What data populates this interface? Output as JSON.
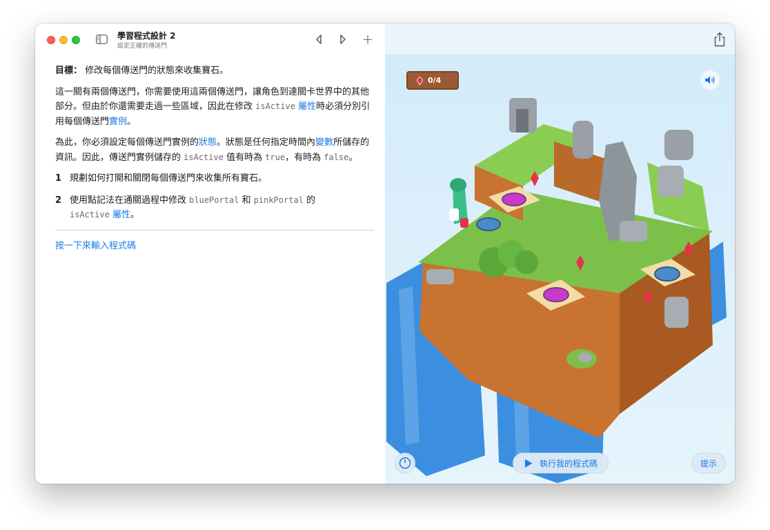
{
  "window": {
    "title": "學習程式設計 2",
    "subtitle": "設定正確的傳送門"
  },
  "toolbar": {
    "back_icon": "chevron-left-icon",
    "forward_icon": "chevron-right-icon",
    "add_label": "+",
    "share_icon": "share-icon",
    "sidebar_icon": "sidebar-icon"
  },
  "instructions": {
    "goal_label": "目標：",
    "goal_text": "修改每個傳送門的狀態來收集寶石。",
    "para1": {
      "part1": "這一關有兩個傳送門，你需要使用這兩個傳送門，讓角色到達關卡世界中的其他部分。但由於你還需要走過一些區域，因此在修改 ",
      "code1": "isActive",
      "link1": "屬性",
      "part2": "時必須分別引用每個傳送門",
      "link2": "實例",
      "part3": "。"
    },
    "para2": {
      "part1": "為此，你必須設定每個傳送門實例的",
      "link1": "狀態",
      "part2": "。狀態是任何指定時間內",
      "link2": "變數",
      "part3": "所儲存的資訊。因此，傳送門實例儲存的 ",
      "code1": "isActive",
      "part4": " 值有時為 ",
      "code2": "true",
      "part5": "，有時為 ",
      "code3": "false",
      "part6": "。"
    },
    "steps": [
      {
        "num": "1",
        "text": "規劃如何打開和關閉每個傳送門來收集所有寶石。"
      },
      {
        "num": "2",
        "part1": "使用點記法在通關過程中修改 ",
        "code1": "bluePortal",
        "part2": " 和 ",
        "code2": "pinkPortal",
        "part3": " 的 ",
        "code3": "isActive",
        "part4": " ",
        "link1": "屬性",
        "part5": "。"
      }
    ],
    "cta": "按一下來輸入程式碼"
  },
  "game": {
    "gem_count": "0/4",
    "gems_collected": 0,
    "gems_total": 4,
    "run_label": "執行我的程式碼",
    "hint_label": "提示",
    "speed_icon": "speedometer-icon",
    "sound_icon": "speaker-icon",
    "colors": {
      "grass": "#7cc04a",
      "dirt": "#c8732f",
      "water": "#3c8ee0",
      "gem": "#e8304a",
      "pink_portal": "#c93ac8",
      "blue_portal": "#4a8cc9",
      "accent": "#1a7ae6"
    }
  }
}
